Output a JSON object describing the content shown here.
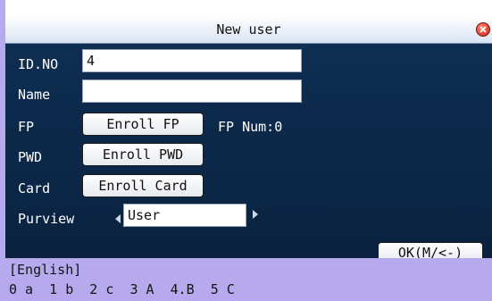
{
  "dialog": {
    "title": "New user",
    "close_icon": "close-icon"
  },
  "form": {
    "id_label": "ID.NO",
    "id_value": "4",
    "name_label": "Name",
    "name_value": "",
    "fp_label": "FP",
    "fp_button": "Enroll FP",
    "fp_num": "FP Num:0",
    "pwd_label": "PWD",
    "pwd_button": "Enroll PWD",
    "card_label": "Card",
    "card_button": "Enroll Card",
    "purview_label": "Purview",
    "purview_value": "User",
    "ok_button": "OK(M/<-)"
  },
  "ime": {
    "language": "[English]",
    "candidates": "0 a  1 b  2 c  3 A  4.B  5 C"
  },
  "colors": {
    "panel": "#0c2744",
    "ime_bar": "#b6a9ee",
    "close": "#c71f12"
  }
}
